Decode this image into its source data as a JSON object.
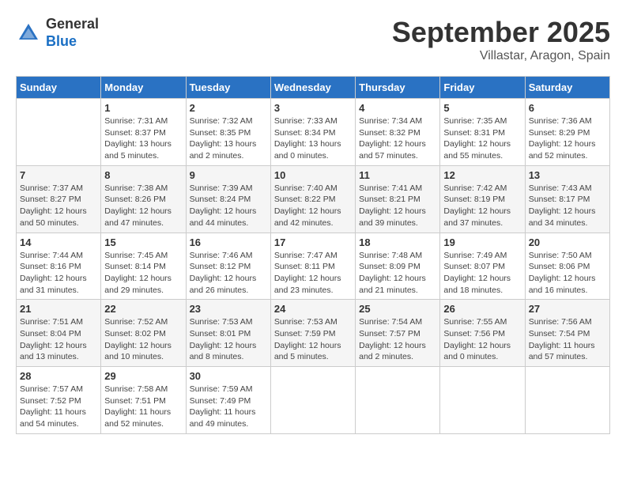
{
  "header": {
    "logo_general": "General",
    "logo_blue": "Blue",
    "month_title": "September 2025",
    "location": "Villastar, Aragon, Spain"
  },
  "days_of_week": [
    "Sunday",
    "Monday",
    "Tuesday",
    "Wednesday",
    "Thursday",
    "Friday",
    "Saturday"
  ],
  "weeks": [
    [
      {
        "day": "",
        "info": ""
      },
      {
        "day": "1",
        "info": "Sunrise: 7:31 AM\nSunset: 8:37 PM\nDaylight: 13 hours\nand 5 minutes."
      },
      {
        "day": "2",
        "info": "Sunrise: 7:32 AM\nSunset: 8:35 PM\nDaylight: 13 hours\nand 2 minutes."
      },
      {
        "day": "3",
        "info": "Sunrise: 7:33 AM\nSunset: 8:34 PM\nDaylight: 13 hours\nand 0 minutes."
      },
      {
        "day": "4",
        "info": "Sunrise: 7:34 AM\nSunset: 8:32 PM\nDaylight: 12 hours\nand 57 minutes."
      },
      {
        "day": "5",
        "info": "Sunrise: 7:35 AM\nSunset: 8:31 PM\nDaylight: 12 hours\nand 55 minutes."
      },
      {
        "day": "6",
        "info": "Sunrise: 7:36 AM\nSunset: 8:29 PM\nDaylight: 12 hours\nand 52 minutes."
      }
    ],
    [
      {
        "day": "7",
        "info": "Sunrise: 7:37 AM\nSunset: 8:27 PM\nDaylight: 12 hours\nand 50 minutes."
      },
      {
        "day": "8",
        "info": "Sunrise: 7:38 AM\nSunset: 8:26 PM\nDaylight: 12 hours\nand 47 minutes."
      },
      {
        "day": "9",
        "info": "Sunrise: 7:39 AM\nSunset: 8:24 PM\nDaylight: 12 hours\nand 44 minutes."
      },
      {
        "day": "10",
        "info": "Sunrise: 7:40 AM\nSunset: 8:22 PM\nDaylight: 12 hours\nand 42 minutes."
      },
      {
        "day": "11",
        "info": "Sunrise: 7:41 AM\nSunset: 8:21 PM\nDaylight: 12 hours\nand 39 minutes."
      },
      {
        "day": "12",
        "info": "Sunrise: 7:42 AM\nSunset: 8:19 PM\nDaylight: 12 hours\nand 37 minutes."
      },
      {
        "day": "13",
        "info": "Sunrise: 7:43 AM\nSunset: 8:17 PM\nDaylight: 12 hours\nand 34 minutes."
      }
    ],
    [
      {
        "day": "14",
        "info": "Sunrise: 7:44 AM\nSunset: 8:16 PM\nDaylight: 12 hours\nand 31 minutes."
      },
      {
        "day": "15",
        "info": "Sunrise: 7:45 AM\nSunset: 8:14 PM\nDaylight: 12 hours\nand 29 minutes."
      },
      {
        "day": "16",
        "info": "Sunrise: 7:46 AM\nSunset: 8:12 PM\nDaylight: 12 hours\nand 26 minutes."
      },
      {
        "day": "17",
        "info": "Sunrise: 7:47 AM\nSunset: 8:11 PM\nDaylight: 12 hours\nand 23 minutes."
      },
      {
        "day": "18",
        "info": "Sunrise: 7:48 AM\nSunset: 8:09 PM\nDaylight: 12 hours\nand 21 minutes."
      },
      {
        "day": "19",
        "info": "Sunrise: 7:49 AM\nSunset: 8:07 PM\nDaylight: 12 hours\nand 18 minutes."
      },
      {
        "day": "20",
        "info": "Sunrise: 7:50 AM\nSunset: 8:06 PM\nDaylight: 12 hours\nand 16 minutes."
      }
    ],
    [
      {
        "day": "21",
        "info": "Sunrise: 7:51 AM\nSunset: 8:04 PM\nDaylight: 12 hours\nand 13 minutes."
      },
      {
        "day": "22",
        "info": "Sunrise: 7:52 AM\nSunset: 8:02 PM\nDaylight: 12 hours\nand 10 minutes."
      },
      {
        "day": "23",
        "info": "Sunrise: 7:53 AM\nSunset: 8:01 PM\nDaylight: 12 hours\nand 8 minutes."
      },
      {
        "day": "24",
        "info": "Sunrise: 7:53 AM\nSunset: 7:59 PM\nDaylight: 12 hours\nand 5 minutes."
      },
      {
        "day": "25",
        "info": "Sunrise: 7:54 AM\nSunset: 7:57 PM\nDaylight: 12 hours\nand 2 minutes."
      },
      {
        "day": "26",
        "info": "Sunrise: 7:55 AM\nSunset: 7:56 PM\nDaylight: 12 hours\nand 0 minutes."
      },
      {
        "day": "27",
        "info": "Sunrise: 7:56 AM\nSunset: 7:54 PM\nDaylight: 11 hours\nand 57 minutes."
      }
    ],
    [
      {
        "day": "28",
        "info": "Sunrise: 7:57 AM\nSunset: 7:52 PM\nDaylight: 11 hours\nand 54 minutes."
      },
      {
        "day": "29",
        "info": "Sunrise: 7:58 AM\nSunset: 7:51 PM\nDaylight: 11 hours\nand 52 minutes."
      },
      {
        "day": "30",
        "info": "Sunrise: 7:59 AM\nSunset: 7:49 PM\nDaylight: 11 hours\nand 49 minutes."
      },
      {
        "day": "",
        "info": ""
      },
      {
        "day": "",
        "info": ""
      },
      {
        "day": "",
        "info": ""
      },
      {
        "day": "",
        "info": ""
      }
    ]
  ]
}
